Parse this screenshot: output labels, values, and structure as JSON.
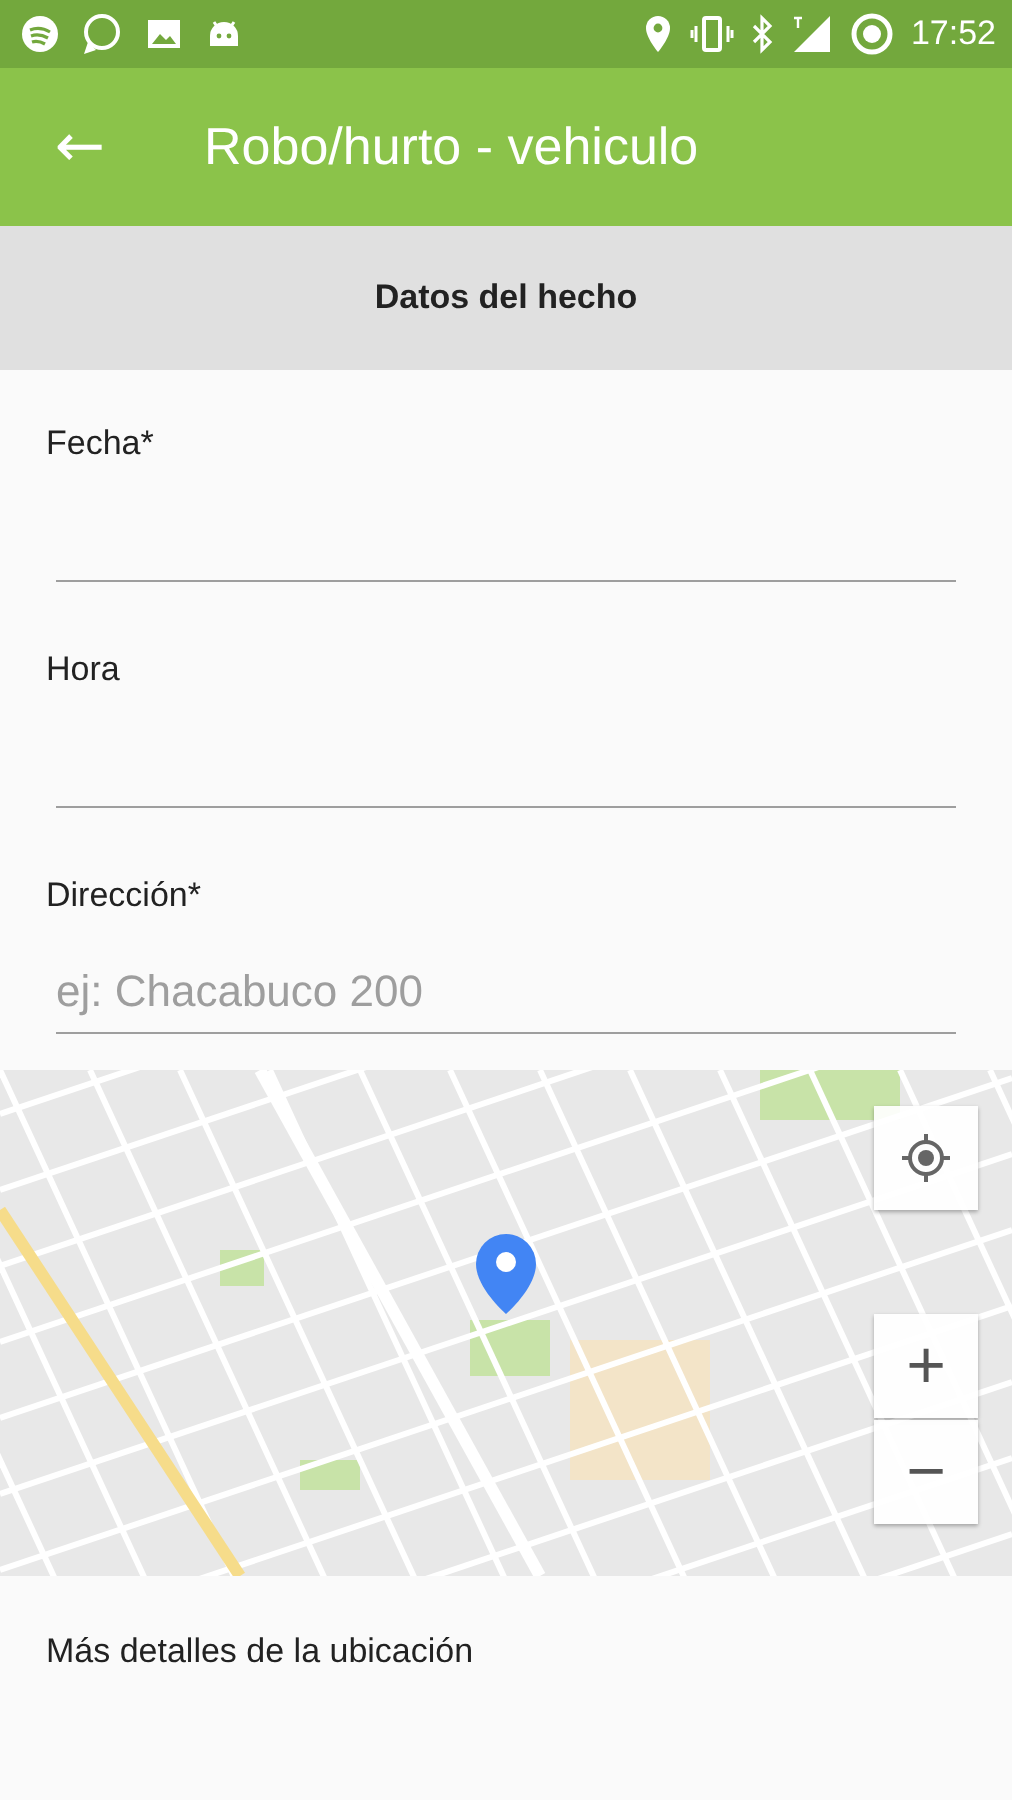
{
  "status_bar": {
    "time": "17:52"
  },
  "app_bar": {
    "back": "←",
    "title": "Robo/hurto - vehiculo"
  },
  "section": {
    "title": "Datos del hecho"
  },
  "fields": [
    {
      "label": "Fecha*"
    },
    {
      "label": "Hora"
    },
    {
      "label": "Dirección*",
      "placeholder": "ej: Chacabuco 200"
    }
  ],
  "map": {
    "kind": "picture",
    "zoom_in": "+",
    "zoom_out": "−"
  },
  "details": {
    "label": "Más detalles de la ubicación"
  }
}
